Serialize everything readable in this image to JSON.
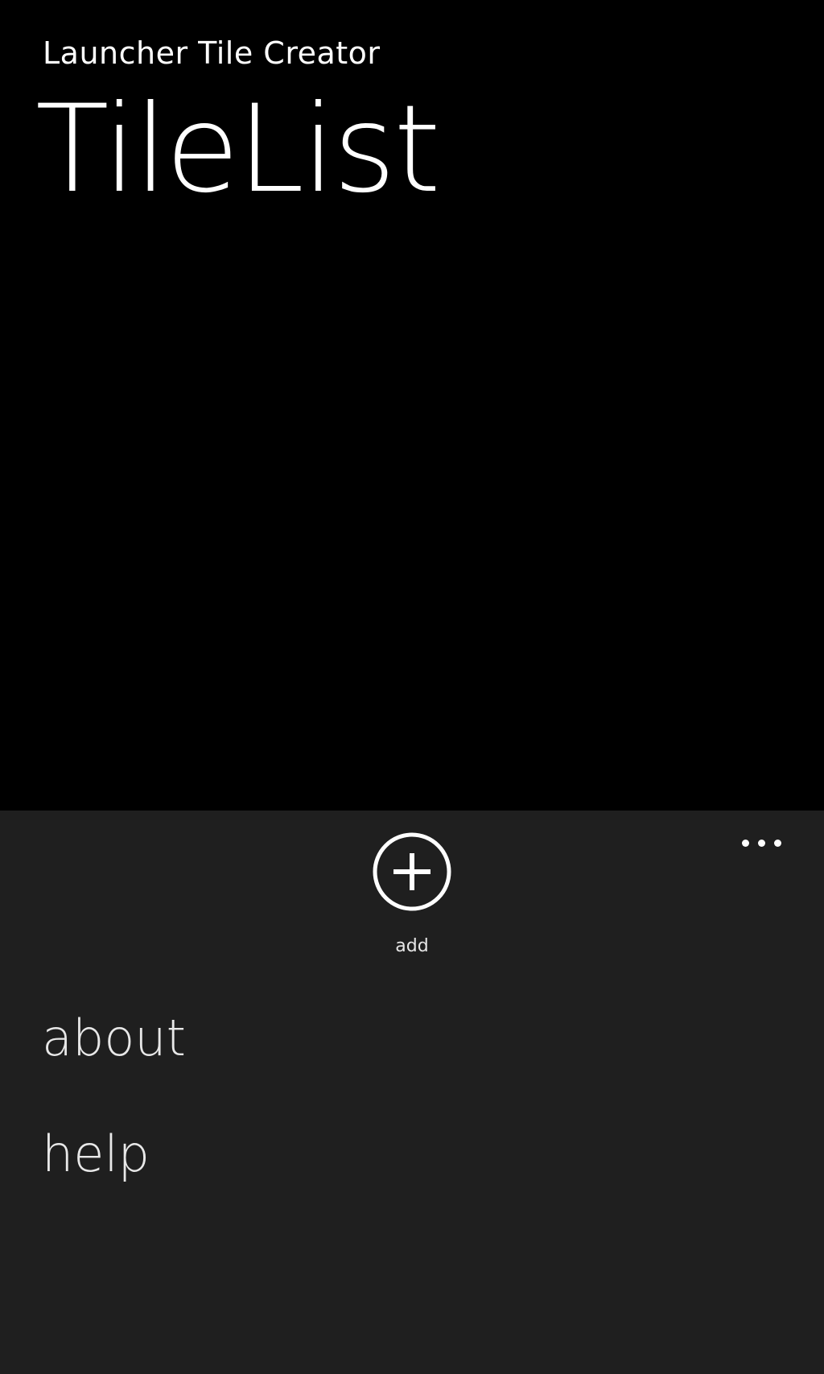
{
  "header": {
    "app_title": "Launcher Tile Creator",
    "page_title": "TileList"
  },
  "app_bar": {
    "background_color": "#1f1f1f",
    "add_button": {
      "icon": "add-circle-icon",
      "label": "add"
    },
    "more_button": {
      "icon": "ellipsis-icon"
    },
    "menu_items": [
      {
        "label": "about"
      },
      {
        "label": "help"
      }
    ]
  },
  "theme": {
    "page_background": "#000000",
    "foreground": "#ffffff"
  }
}
